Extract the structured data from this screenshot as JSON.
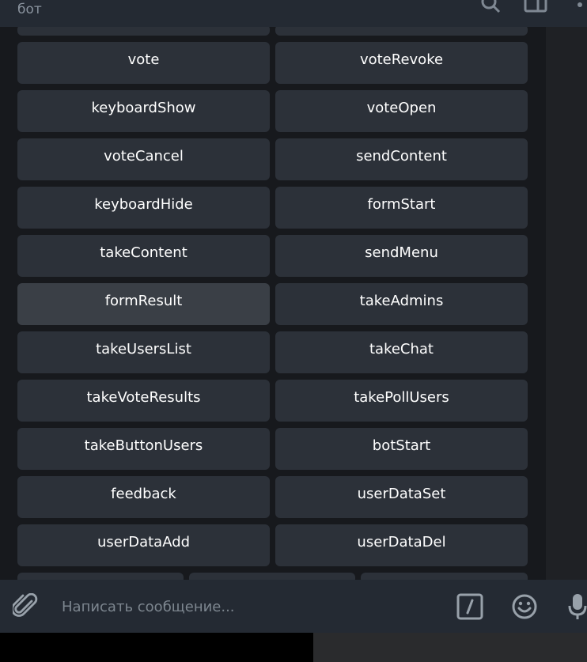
{
  "header": {
    "subtitle": "бот"
  },
  "keyboard": {
    "rows": [
      [
        "vote",
        "voteRevoke"
      ],
      [
        "keyboardShow",
        "voteOpen"
      ],
      [
        "voteCancel",
        "sendContent"
      ],
      [
        "keyboardHide",
        "formStart"
      ],
      [
        "takeContent",
        "sendMenu"
      ],
      [
        "formResult",
        "takeAdmins"
      ],
      [
        "takeUsersList",
        "takeChat"
      ],
      [
        "takeVoteResults",
        "takePollUsers"
      ],
      [
        "takeButtonUsers",
        "botStart"
      ],
      [
        "feedback",
        "userDataSet"
      ],
      [
        "userDataAdd",
        "userDataDel"
      ]
    ],
    "hovered": "formResult"
  },
  "composer": {
    "placeholder": "Написать сообщение..."
  },
  "icons": {
    "header": [
      "search-icon",
      "columns-icon",
      "more-vertical-icon"
    ],
    "composer": [
      "attach-icon",
      "bot-commands-icon",
      "emoji-icon",
      "microphone-icon"
    ]
  },
  "colors": {
    "button_bg": "#2c3139",
    "button_hover_bg": "#3a3f46",
    "panel_bg": "#242a33",
    "chat_bg": "#17191d"
  }
}
